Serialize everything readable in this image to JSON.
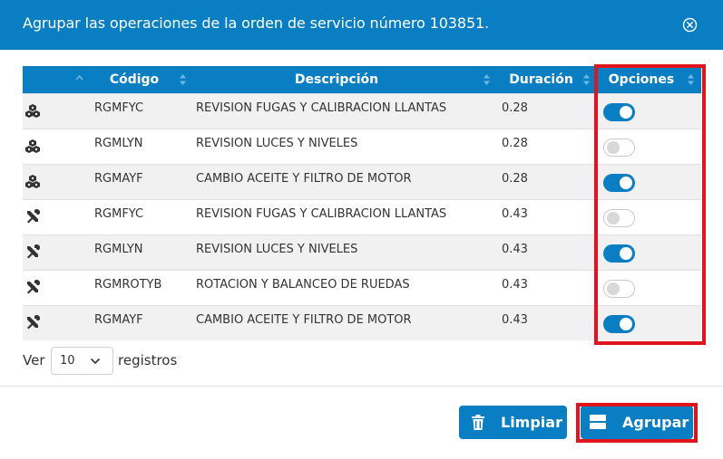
{
  "dialog": {
    "title": "Agrupar las operaciones de la orden de servicio número 103851."
  },
  "table": {
    "columns": {
      "codigo": "Código",
      "descripcion": "Descripción",
      "duracion": "Duración",
      "opciones": "Opciones"
    },
    "rows": [
      {
        "icon": "packages-icon",
        "codigo": "RGMFYC",
        "descripcion": "REVISION FUGAS Y CALIBRACION LLANTAS",
        "duracion": "0.28",
        "enabled": true
      },
      {
        "icon": "packages-icon",
        "codigo": "RGMLYN",
        "descripcion": "REVISION LUCES Y NIVELES",
        "duracion": "0.28",
        "enabled": false
      },
      {
        "icon": "packages-icon",
        "codigo": "RGMAYF",
        "descripcion": "CAMBIO ACEITE Y FILTRO DE MOTOR",
        "duracion": "0.28",
        "enabled": true
      },
      {
        "icon": "tools-icon",
        "codigo": "RGMFYC",
        "descripcion": "REVISION FUGAS Y CALIBRACION LLANTAS",
        "duracion": "0.43",
        "enabled": false
      },
      {
        "icon": "tools-icon",
        "codigo": "RGMLYN",
        "descripcion": "REVISION LUCES Y NIVELES",
        "duracion": "0.43",
        "enabled": true
      },
      {
        "icon": "tools-icon",
        "codigo": "RGMROTYB",
        "descripcion": "ROTACION Y BALANCEO DE RUEDAS",
        "duracion": "0.43",
        "enabled": false
      },
      {
        "icon": "tools-icon",
        "codigo": "RGMAYF",
        "descripcion": "CAMBIO ACEITE Y FILTRO DE MOTOR",
        "duracion": "0.43",
        "enabled": true
      }
    ]
  },
  "length": {
    "label_before": "Ver",
    "value": "10",
    "label_after": "registros"
  },
  "buttons": {
    "limpiar": "Limpiar",
    "agrupar": "Agrupar"
  },
  "colors": {
    "primary": "#0a7ec3",
    "highlight": "#e0141c"
  }
}
